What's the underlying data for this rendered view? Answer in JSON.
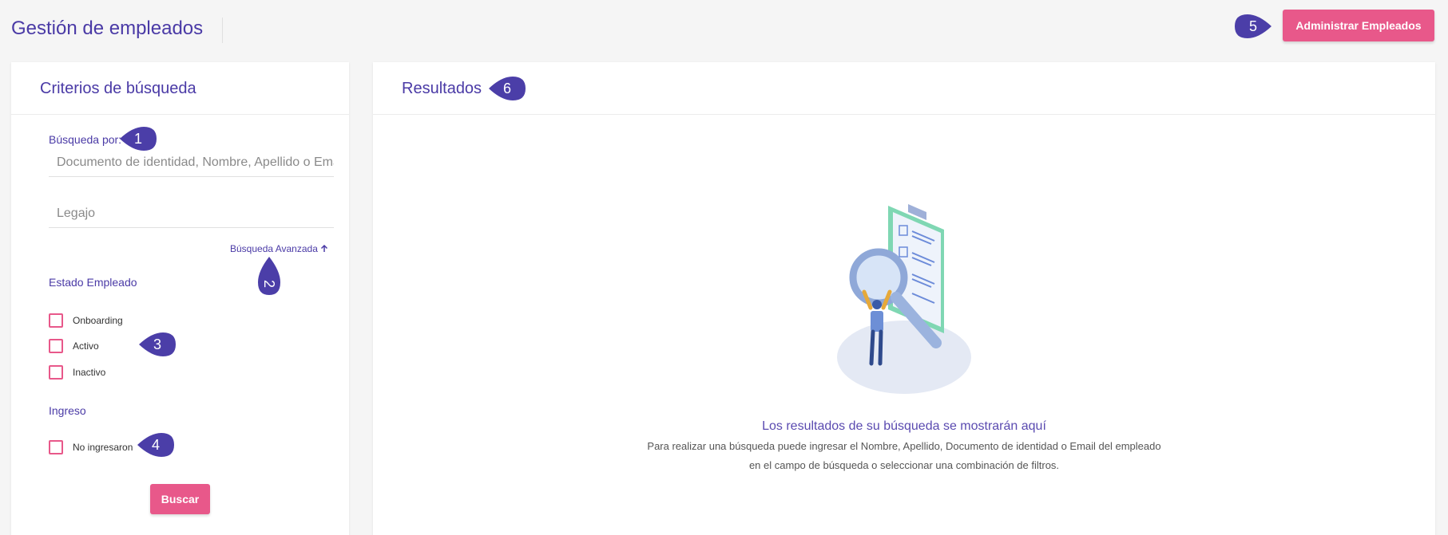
{
  "header": {
    "title": "Gestión de empleados",
    "admin_button": "Administrar Empleados"
  },
  "search_panel": {
    "title": "Criterios de búsqueda",
    "search_by_label": "Búsqueda por:",
    "search_placeholder": "Documento de identidad, Nombre, Apellido o Email",
    "legajo_placeholder": "Legajo",
    "advanced_link": "Búsqueda Avanzada",
    "status_section": "Estado Empleado",
    "status_options": [
      "Onboarding",
      "Activo",
      "Inactivo"
    ],
    "ingreso_section": "Ingreso",
    "ingreso_options": [
      "No ingresaron"
    ],
    "search_button": "Buscar"
  },
  "results_panel": {
    "title": "Resultados",
    "empty_title": "Los resultados de su búsqueda se mostrarán aquí",
    "empty_description": "Para realizar una búsqueda puede ingresar el Nombre, Apellido, Documento de identidad o Email del empleado en el campo de búsqueda o seleccionar una combinación de filtros."
  },
  "markers": [
    "1",
    "2",
    "3",
    "4",
    "5",
    "6"
  ],
  "colors": {
    "accent_purple": "#4a3aa6",
    "marker_purple": "#4b3ea8",
    "button_pink": "#e8588a",
    "background": "#f5f5f5"
  }
}
